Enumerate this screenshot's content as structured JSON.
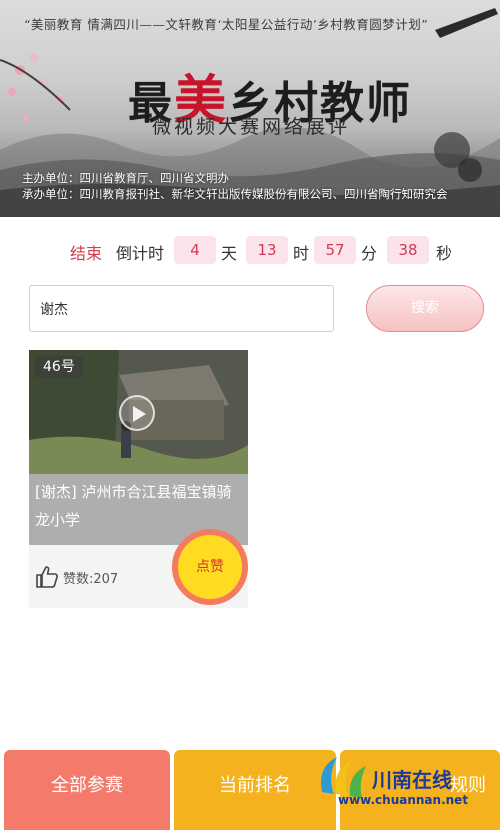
{
  "banner": {
    "slogan": "“美丽教育 情满四川——文轩教育‘太阳星公益行动’乡村教育圆梦计划”",
    "title_pre": "最",
    "title_hl": "美",
    "title_post": "乡村教师",
    "subtitle": "微视频大赛网络展评",
    "host": "主办单位：四川省教育厅、四川省文明办",
    "organizer": "承办单位：四川教育报刊社、新华文轩出版传媒股份有限公司、四川省陶行知研究会"
  },
  "countdown": {
    "status": "结束",
    "label": "倒计时",
    "days": "4",
    "days_unit": "天",
    "hours": "13",
    "hours_unit": "时",
    "minutes": "57",
    "minutes_unit": "分",
    "seconds": "38",
    "seconds_unit": "秒"
  },
  "search": {
    "value": "谢杰",
    "button_label": "搜索"
  },
  "entry": {
    "number": "46号",
    "caption": "[谢杰] 泸州市合江县福宝镇骑龙小学",
    "votes_label": "赞数:207",
    "like_label": "点赞"
  },
  "nav": {
    "all": "全部参赛",
    "ranking": "当前排名",
    "rules": "规则"
  },
  "watermark": {
    "name": "川南在线",
    "url": "www.chuannan.net"
  },
  "colors": {
    "countdown_accent": "#d13b4d",
    "nav_all_bg": "#f47a6c",
    "nav_ranking_bg": "#f4b21f",
    "like_fill": "#ffdb22",
    "like_ring": "#f37c5f"
  }
}
